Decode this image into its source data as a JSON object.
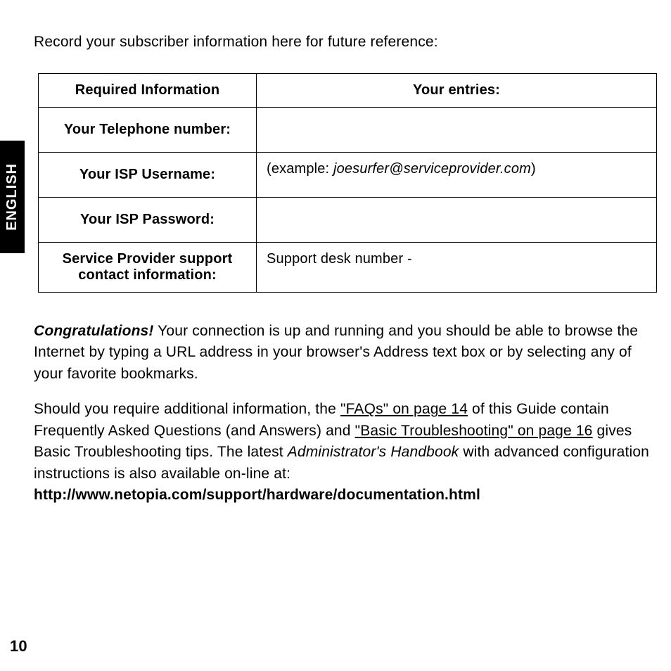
{
  "language_tab": "ENGLISH",
  "intro_text": "Record your subscriber information here for future reference:",
  "table": {
    "header_left": "Required Information",
    "header_right": "Your entries:",
    "rows": [
      {
        "label": "Your Telephone number:",
        "entry": ""
      },
      {
        "label": "Your ISP Username:",
        "entry_prefix": "(example: ",
        "entry_italic": "joesurfer@serviceprovider.com",
        "entry_suffix": ")"
      },
      {
        "label": "Your ISP Password:",
        "entry": ""
      },
      {
        "label": "Service Provider support contact information:",
        "entry": "Support desk number -"
      }
    ]
  },
  "para1": {
    "congrats": "Congratulations!",
    "rest": " Your connection is up and running and you should be able to browse the Internet by typing a URL address in your browser's Address text box or by selecting any of your favorite bookmarks."
  },
  "para2": {
    "part1": "Should you require additional information, the ",
    "link1": "\"FAQs\" on page 14",
    "part2": " of this Guide contain Frequently Asked Questions (and Answers) and ",
    "link2": "\"Basic Troubleshooting\" on page 16",
    "part3": " gives Basic Troubleshooting tips. The latest ",
    "handbook": "Administrator's Handbook",
    "part4": " with advanced configuration instructions is also available on-line at: ",
    "url": "http://www.netopia.com/support/hardware/documentation.html"
  },
  "page_number": "10"
}
